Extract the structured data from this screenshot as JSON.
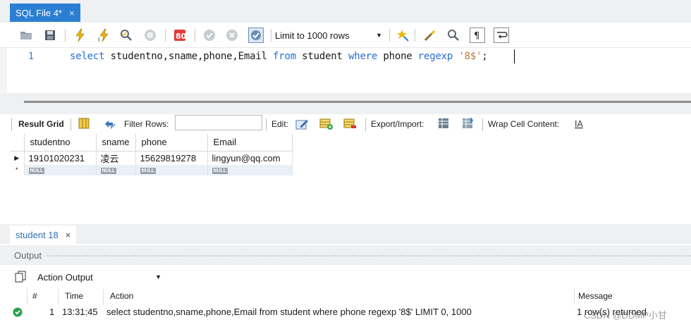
{
  "editor_tab": {
    "title": "SQL File 4*",
    "close": "×"
  },
  "toolbar": {
    "limit_label": "Limit to 1000 rows",
    "icons": [
      "open-folder-icon",
      "save-icon",
      "execute-icon",
      "execute-current-icon",
      "explain-icon",
      "stop-icon",
      "toggle-continue-icon",
      "commit-icon",
      "rollback-icon",
      "autocommit-icon",
      "beautify-icon",
      "find-icon",
      "invisible-chars-icon",
      "wrap-icon"
    ]
  },
  "editor": {
    "line_number": "1",
    "tokens": [
      {
        "text": "select",
        "kind": "kw"
      },
      {
        "text": " studentno,sname,phone,Email ",
        "kind": "plain"
      },
      {
        "text": "from",
        "kind": "kw"
      },
      {
        "text": " student ",
        "kind": "plain"
      },
      {
        "text": "where",
        "kind": "kw"
      },
      {
        "text": " phone ",
        "kind": "plain"
      },
      {
        "text": "regexp",
        "kind": "kw"
      },
      {
        "text": " ",
        "kind": "plain"
      },
      {
        "text": "'8$'",
        "kind": "str"
      },
      {
        "text": ";",
        "kind": "plain"
      }
    ]
  },
  "result_toolbar": {
    "result_grid": "Result Grid",
    "filter_rows": "Filter Rows:",
    "filter_value": "",
    "edit": "Edit:",
    "export_import": "Export/Import:",
    "wrap_cell": "Wrap Cell Content:"
  },
  "grid": {
    "columns": [
      "studentno",
      "sname",
      "phone",
      "Email"
    ],
    "rows": [
      {
        "marker": "▶",
        "cells": [
          "19101020231",
          "凌云",
          "15629819278",
          "lingyun@qq.com"
        ]
      },
      {
        "marker": "*",
        "cells": [
          "NULL",
          "NULL",
          "NULL",
          "NULL"
        ]
      }
    ]
  },
  "result_tab": {
    "label": "student 18",
    "close": "×"
  },
  "output": {
    "title": "Output",
    "selector": "Action Output",
    "columns": {
      "num": "#",
      "time": "Time",
      "action": "Action",
      "message": "Message"
    },
    "rows": [
      {
        "num": "1",
        "time": "13:31:45",
        "action": "select studentno,sname,phone,Email from student where phone regexp '8$' LIMIT 0, 1000",
        "message": "1 row(s) returned"
      }
    ]
  },
  "watermark": "CSDN @DDMP小甘",
  "colors": {
    "accent": "#2b7fd3",
    "keyword": "#2a6fd6",
    "string": "#c07b3a",
    "success": "#2e9e4f"
  }
}
